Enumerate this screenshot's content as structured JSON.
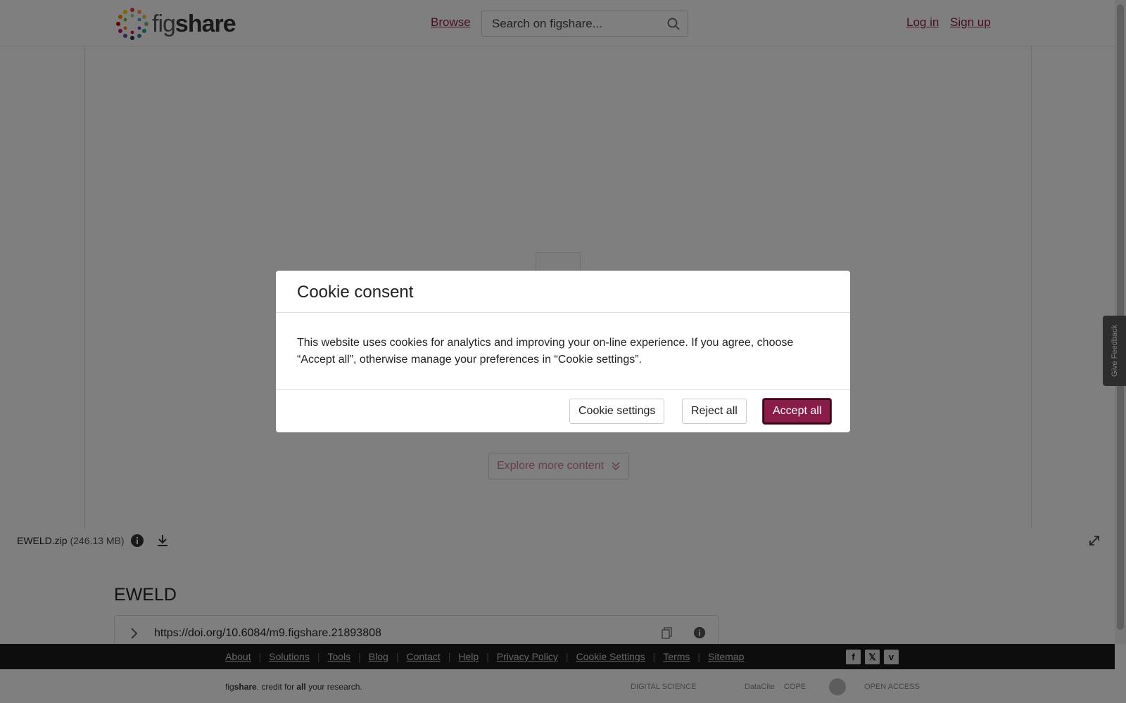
{
  "header": {
    "logo_text_a": "fig",
    "logo_text_b": "share",
    "browse": "Browse",
    "search_placeholder": "Search on figshare...",
    "login": "Log in",
    "signup": "Sign up"
  },
  "viewer": {
    "explore": "Explore more content"
  },
  "file": {
    "name": "EWELD.zip",
    "size": "(246.13 MB)"
  },
  "item": {
    "title": "EWELD",
    "doi": "https://doi.org/10.6084/m9.figshare.21893808"
  },
  "footer": {
    "links": [
      "About",
      "Solutions",
      "Tools",
      "Blog",
      "Contact",
      "Help",
      "Privacy Policy",
      "Cookie Settings",
      "Terms",
      "Sitemap"
    ],
    "tagline_a": "fig",
    "tagline_b": "share",
    "tagline_c": ". credit for ",
    "tagline_d": "all",
    "tagline_e": " your research.",
    "partner_digital": "DIGITAL SCIENCE",
    "partner_datacite": "DataCite",
    "partner_cope": "COPE",
    "partner_oa": "OPEN ACCESS"
  },
  "feedback": "Give Feedback",
  "modal": {
    "title": "Cookie consent",
    "body": "This website uses cookies for analytics and improving your on-line experience. If you agree, choose “Accept all”, otherwise manage your preferences in “Cookie settings”.",
    "settings": "Cookie settings",
    "reject": "Reject all",
    "accept": "Accept all"
  },
  "colors": {
    "brand": "#8a1c4a",
    "footer_bg": "#1a1a1a"
  }
}
